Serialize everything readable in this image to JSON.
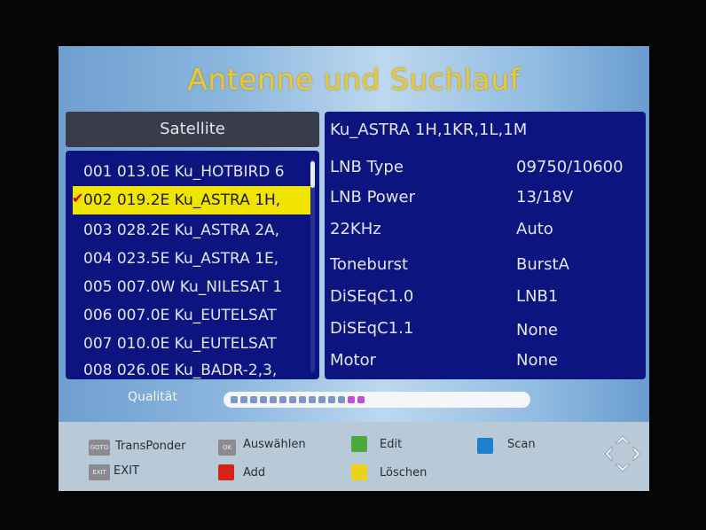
{
  "title": "Antenne und Suchlauf",
  "satellite_panel": {
    "header": "Satellite",
    "items": [
      {
        "label": "001 013.0E Ku_HOTBIRD 6",
        "selected": false
      },
      {
        "label": "002 019.2E Ku_ASTRA 1H,",
        "selected": true
      },
      {
        "label": "003 028.2E Ku_ASTRA 2A,",
        "selected": false
      },
      {
        "label": "004 023.5E Ku_ASTRA 1E,",
        "selected": false
      },
      {
        "label": "005 007.0W Ku_NILESAT 1",
        "selected": false
      },
      {
        "label": "006 007.0E Ku_EUTELSAT",
        "selected": false
      },
      {
        "label": "007 010.0E Ku_EUTELSAT",
        "selected": false
      },
      {
        "label": "008 026.0E Ku_BADR-2,3,",
        "selected": false
      }
    ]
  },
  "info_panel": {
    "title": "Ku_ASTRA 1H,1KR,1L,1M",
    "rows": [
      {
        "label": "LNB Type",
        "value": "09750/10600"
      },
      {
        "label": "LNB Power",
        "value": "13/18V"
      },
      {
        "label": "22KHz",
        "value": "Auto"
      },
      {
        "label": "Toneburst",
        "value": "BurstA"
      },
      {
        "label": "DiSEqC1.0",
        "value": "LNB1"
      },
      {
        "label": "DiSEqC1.1",
        "value": "None"
      },
      {
        "label": "Motor",
        "value": "None"
      }
    ]
  },
  "quality": {
    "label": "Qualität",
    "level_fraction": 0.45,
    "colors": {
      "filled": "#7d95c7",
      "peak": "#c24fd8"
    }
  },
  "footer": {
    "transponder_key": "GOTO",
    "transponder_label": "TransPonder",
    "ok_key": "OK",
    "ok_label": "Auswählen",
    "edit_label": "Edit",
    "scan_label": "Scan",
    "exit_key": "EXIT",
    "exit_label": "EXIT",
    "add_label": "Add",
    "delete_label": "Löschen",
    "colors": {
      "green": "#4caa3c",
      "blue": "#1e7fd0",
      "red": "#d42418",
      "yellow": "#ead21c"
    }
  },
  "icons": {
    "check": "check-mark-icon",
    "nav": "navigation-arrows-icon"
  }
}
